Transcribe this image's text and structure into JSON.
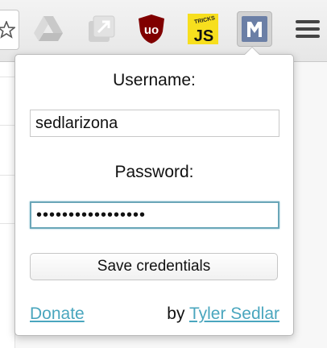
{
  "toolbar": {
    "extensions": [
      {
        "name": "star-icon"
      },
      {
        "name": "google-drive-icon"
      },
      {
        "name": "open-in-new-window-icon"
      },
      {
        "name": "ublock-origin-icon",
        "text": "uo",
        "color": "#800000"
      },
      {
        "name": "js-tricks-icon",
        "text": "JS",
        "small_text": "TRICKS",
        "color": "#f7df1e"
      },
      {
        "name": "m-extension-icon",
        "text": "M",
        "color": "#6b7fa6",
        "active": true
      },
      {
        "name": "menu-icon"
      }
    ]
  },
  "popup": {
    "username_label": "Username:",
    "username_value": "sedlarizona",
    "password_label": "Password:",
    "password_masked": "•••••••••••••••••",
    "save_button": "Save credentials",
    "donate_link": "Donate",
    "byline_prefix": "by",
    "author_link": "Tyler Sedlar",
    "link_color": "#4aa6be",
    "focus_color": "#6aa6b8"
  }
}
